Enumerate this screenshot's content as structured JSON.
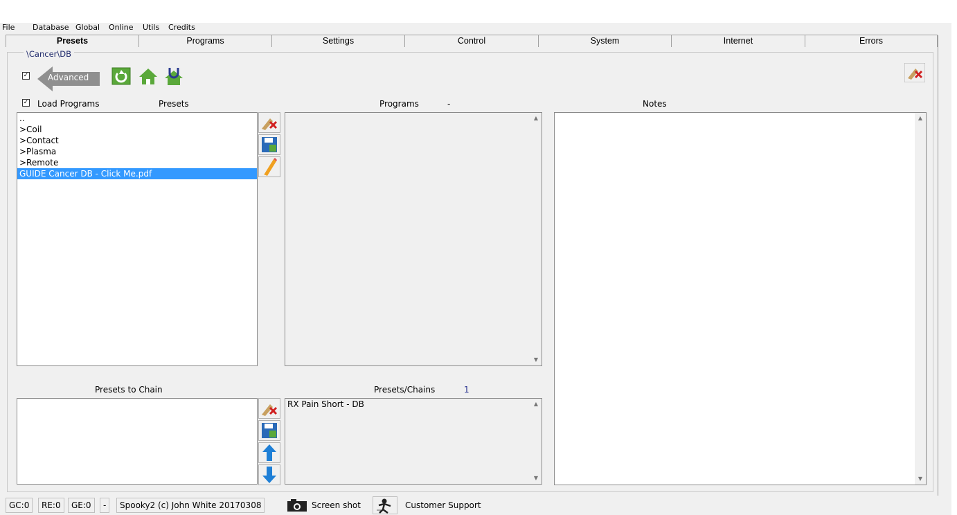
{
  "menu": [
    "File",
    "Database",
    "Global",
    "Online",
    "Utils",
    "Credits"
  ],
  "tabs": [
    "Presets",
    "Programs",
    "Settings",
    "Control",
    "System",
    "Internet",
    "Errors"
  ],
  "active_tab": "Presets",
  "path": "\\Cancer\\DB",
  "advanced": {
    "label": "Advanced",
    "checked": true
  },
  "load_programs": {
    "label": "Load Programs",
    "checked": true
  },
  "headers": {
    "presets": "Presets",
    "programs": "Programs",
    "programs_count": "-",
    "notes": "Notes",
    "presets_to_chain": "Presets to Chain",
    "presets_chains": "Presets/Chains",
    "presets_chains_count": "1"
  },
  "presets_list": [
    "..",
    ">Coil",
    ">Contact",
    ">Plasma",
    ">Remote",
    "GUIDE Cancer DB - Click Me.pdf"
  ],
  "selected_preset": "GUIDE Cancer DB - Click Me.pdf",
  "presets_chains_list": [
    "RX Pain Short - DB"
  ],
  "status": {
    "gc": "GC:0",
    "re": "RE:0",
    "ge": "GE:0",
    "dash": "-",
    "copyright": "Spooky2 (c) John White 20170308",
    "screenshot": "Screen shot",
    "support": "Customer Support"
  },
  "colors": {
    "selection": "#3399ff",
    "icon_green": "#5aa83a",
    "arrow_gray": "#8f8f8f"
  },
  "icons": [
    "refresh-icon",
    "home-icon",
    "user-home-icon",
    "clear-icon",
    "save-icon",
    "edit-icon",
    "up-arrow-icon",
    "down-arrow-icon",
    "camera-icon",
    "support-icon"
  ]
}
